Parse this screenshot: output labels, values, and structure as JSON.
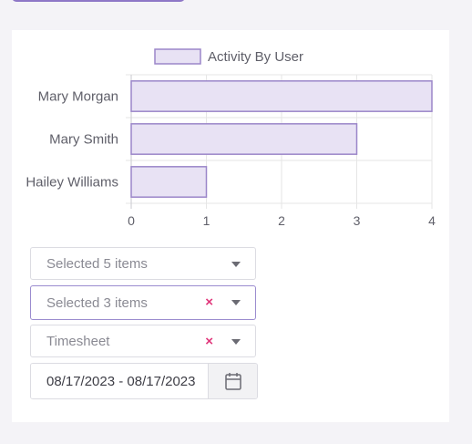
{
  "chart_data": {
    "type": "bar",
    "orientation": "horizontal",
    "categories": [
      "Mary Morgan",
      "Mary Smith",
      "Hailey Williams"
    ],
    "series": [
      {
        "name": "Activity By User",
        "values": [
          4,
          3,
          1
        ]
      }
    ],
    "xlim": [
      0,
      4
    ],
    "xticks": [
      0,
      1,
      2,
      3,
      4
    ],
    "grid": true,
    "legend_position": "top",
    "colors": {
      "fill": "#e8e2f4",
      "stroke": "#9b86c9",
      "grid": "#e6e6e6"
    }
  },
  "filters": {
    "dropdown1": {
      "value": "Selected 5 items"
    },
    "dropdown2": {
      "value": "Selected 3 items",
      "clear": "×"
    },
    "dropdown3": {
      "value": "Timesheet",
      "clear": "×"
    },
    "date_range": {
      "value": "08/17/2023 - 08/17/2023"
    }
  },
  "icons": {
    "dropdown_arrow": "caret-down-icon",
    "clear": "clear-x-icon",
    "calendar": "calendar-icon"
  },
  "colors": {
    "accent": "#8e77c7",
    "clear": "#e0367a",
    "active_border": "#9b8ccf"
  }
}
